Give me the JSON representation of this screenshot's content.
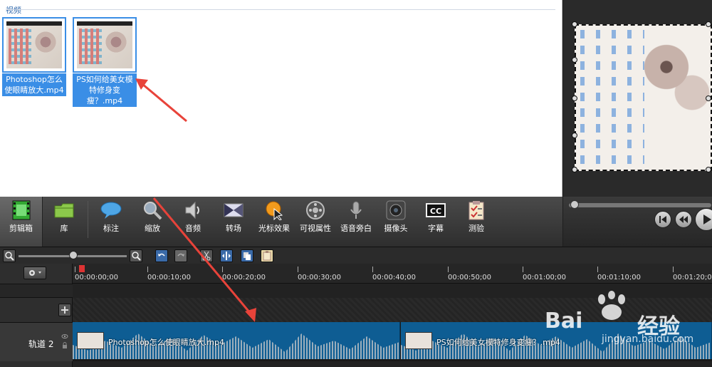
{
  "clip_bin": {
    "section_label": "视频",
    "clips": [
      {
        "name": "Photoshop怎么使眼睛放大.mp4"
      },
      {
        "name": "PS如何给美女模特修身变瘦？.mp4"
      }
    ]
  },
  "toolbar": {
    "tools": [
      {
        "label": "剪辑箱",
        "icon": "film-icon"
      },
      {
        "label": "库",
        "icon": "folder-icon"
      },
      {
        "label": "标注",
        "icon": "speech-bubble-icon"
      },
      {
        "label": "缩放",
        "icon": "magnifier-icon"
      },
      {
        "label": "音频",
        "icon": "speaker-icon"
      },
      {
        "label": "转场",
        "icon": "transition-icon"
      },
      {
        "label": "光标效果",
        "icon": "cursor-icon"
      },
      {
        "label": "可视属性",
        "icon": "film-reel-icon"
      },
      {
        "label": "语音旁白",
        "icon": "microphone-icon"
      },
      {
        "label": "摄像头",
        "icon": "webcam-icon"
      },
      {
        "label": "字幕",
        "icon": "cc-icon"
      },
      {
        "label": "测验",
        "icon": "clipboard-icon"
      }
    ]
  },
  "timeline": {
    "ticks": [
      "00:00:00;00",
      "00:00:10;00",
      "00:00:20;00",
      "00:00:30;00",
      "00:00:40;00",
      "00:00:50;00",
      "00:01:00;00",
      "00:01:10;00",
      "00:01:20;00"
    ],
    "track_label": "轨道 2",
    "segments": [
      {
        "name": "Photoshop怎么使眼睛放大.mp4"
      },
      {
        "name": "PS如何给美女模特修身变瘦？.mp4"
      }
    ]
  },
  "watermark": {
    "brand_left": "Bai",
    "brand_right": "经验",
    "sub": "jingyan.baidu.com"
  },
  "colors": {
    "accent": "#3a8ee6",
    "track": "#0e5d93",
    "arrow": "#e8433a"
  }
}
